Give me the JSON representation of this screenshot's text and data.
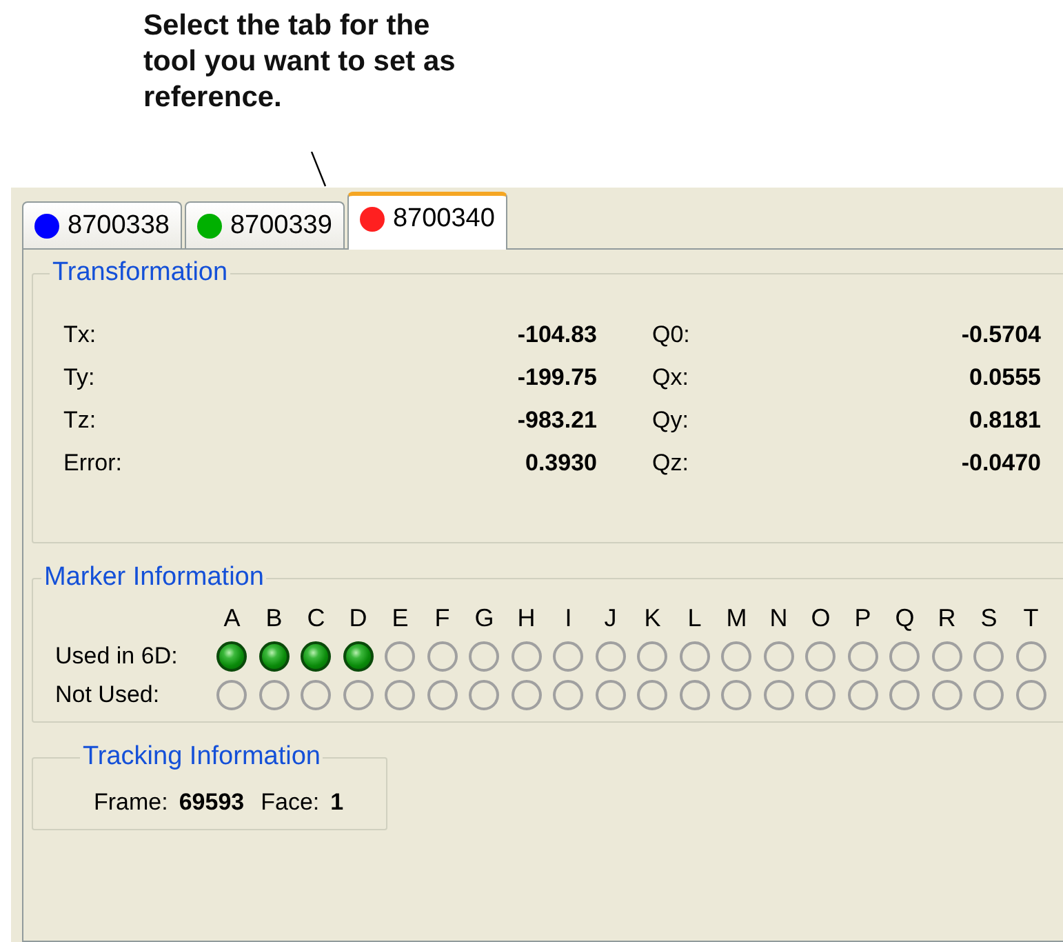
{
  "callout": {
    "text": "Select the tab for the tool you want to set as reference."
  },
  "tabs": [
    {
      "label": "8700338",
      "color": "#0000ff",
      "selected": false
    },
    {
      "label": "8700339",
      "color": "#00b000",
      "selected": false
    },
    {
      "label": "8700340",
      "color": "#ff2020",
      "selected": true
    }
  ],
  "transformation": {
    "title": "Transformation",
    "rows": [
      {
        "label": "Tx:",
        "value": "-104.83",
        "q_label": "Q0:",
        "q_value": "-0.5704"
      },
      {
        "label": "Ty:",
        "value": "-199.75",
        "q_label": "Qx:",
        "q_value": "0.0555"
      },
      {
        "label": "Tz:",
        "value": "-983.21",
        "q_label": "Qy:",
        "q_value": "0.8181"
      },
      {
        "label": "Error:",
        "value": "0.3930",
        "q_label": "Qz:",
        "q_value": "-0.0470"
      }
    ]
  },
  "marker_information": {
    "title": "Marker Information",
    "used_label": "Used in 6D:",
    "not_used_label": "Not Used:",
    "markers": [
      {
        "letter": "A",
        "used_in_6d": true,
        "not_used": false
      },
      {
        "letter": "B",
        "used_in_6d": true,
        "not_used": false
      },
      {
        "letter": "C",
        "used_in_6d": true,
        "not_used": false
      },
      {
        "letter": "D",
        "used_in_6d": true,
        "not_used": false
      },
      {
        "letter": "E",
        "used_in_6d": false,
        "not_used": false
      },
      {
        "letter": "F",
        "used_in_6d": false,
        "not_used": false
      },
      {
        "letter": "G",
        "used_in_6d": false,
        "not_used": false
      },
      {
        "letter": "H",
        "used_in_6d": false,
        "not_used": false
      },
      {
        "letter": "I",
        "used_in_6d": false,
        "not_used": false
      },
      {
        "letter": "J",
        "used_in_6d": false,
        "not_used": false
      },
      {
        "letter": "K",
        "used_in_6d": false,
        "not_used": false
      },
      {
        "letter": "L",
        "used_in_6d": false,
        "not_used": false
      },
      {
        "letter": "M",
        "used_in_6d": false,
        "not_used": false
      },
      {
        "letter": "N",
        "used_in_6d": false,
        "not_used": false
      },
      {
        "letter": "O",
        "used_in_6d": false,
        "not_used": false
      },
      {
        "letter": "P",
        "used_in_6d": false,
        "not_used": false
      },
      {
        "letter": "Q",
        "used_in_6d": false,
        "not_used": false
      },
      {
        "letter": "R",
        "used_in_6d": false,
        "not_used": false
      },
      {
        "letter": "S",
        "used_in_6d": false,
        "not_used": false
      },
      {
        "letter": "T",
        "used_in_6d": false,
        "not_used": false
      }
    ]
  },
  "tracking_information": {
    "title": "Tracking Information",
    "frame_label": "Frame:",
    "frame": "69593",
    "face_label": "Face:",
    "face": "1"
  }
}
